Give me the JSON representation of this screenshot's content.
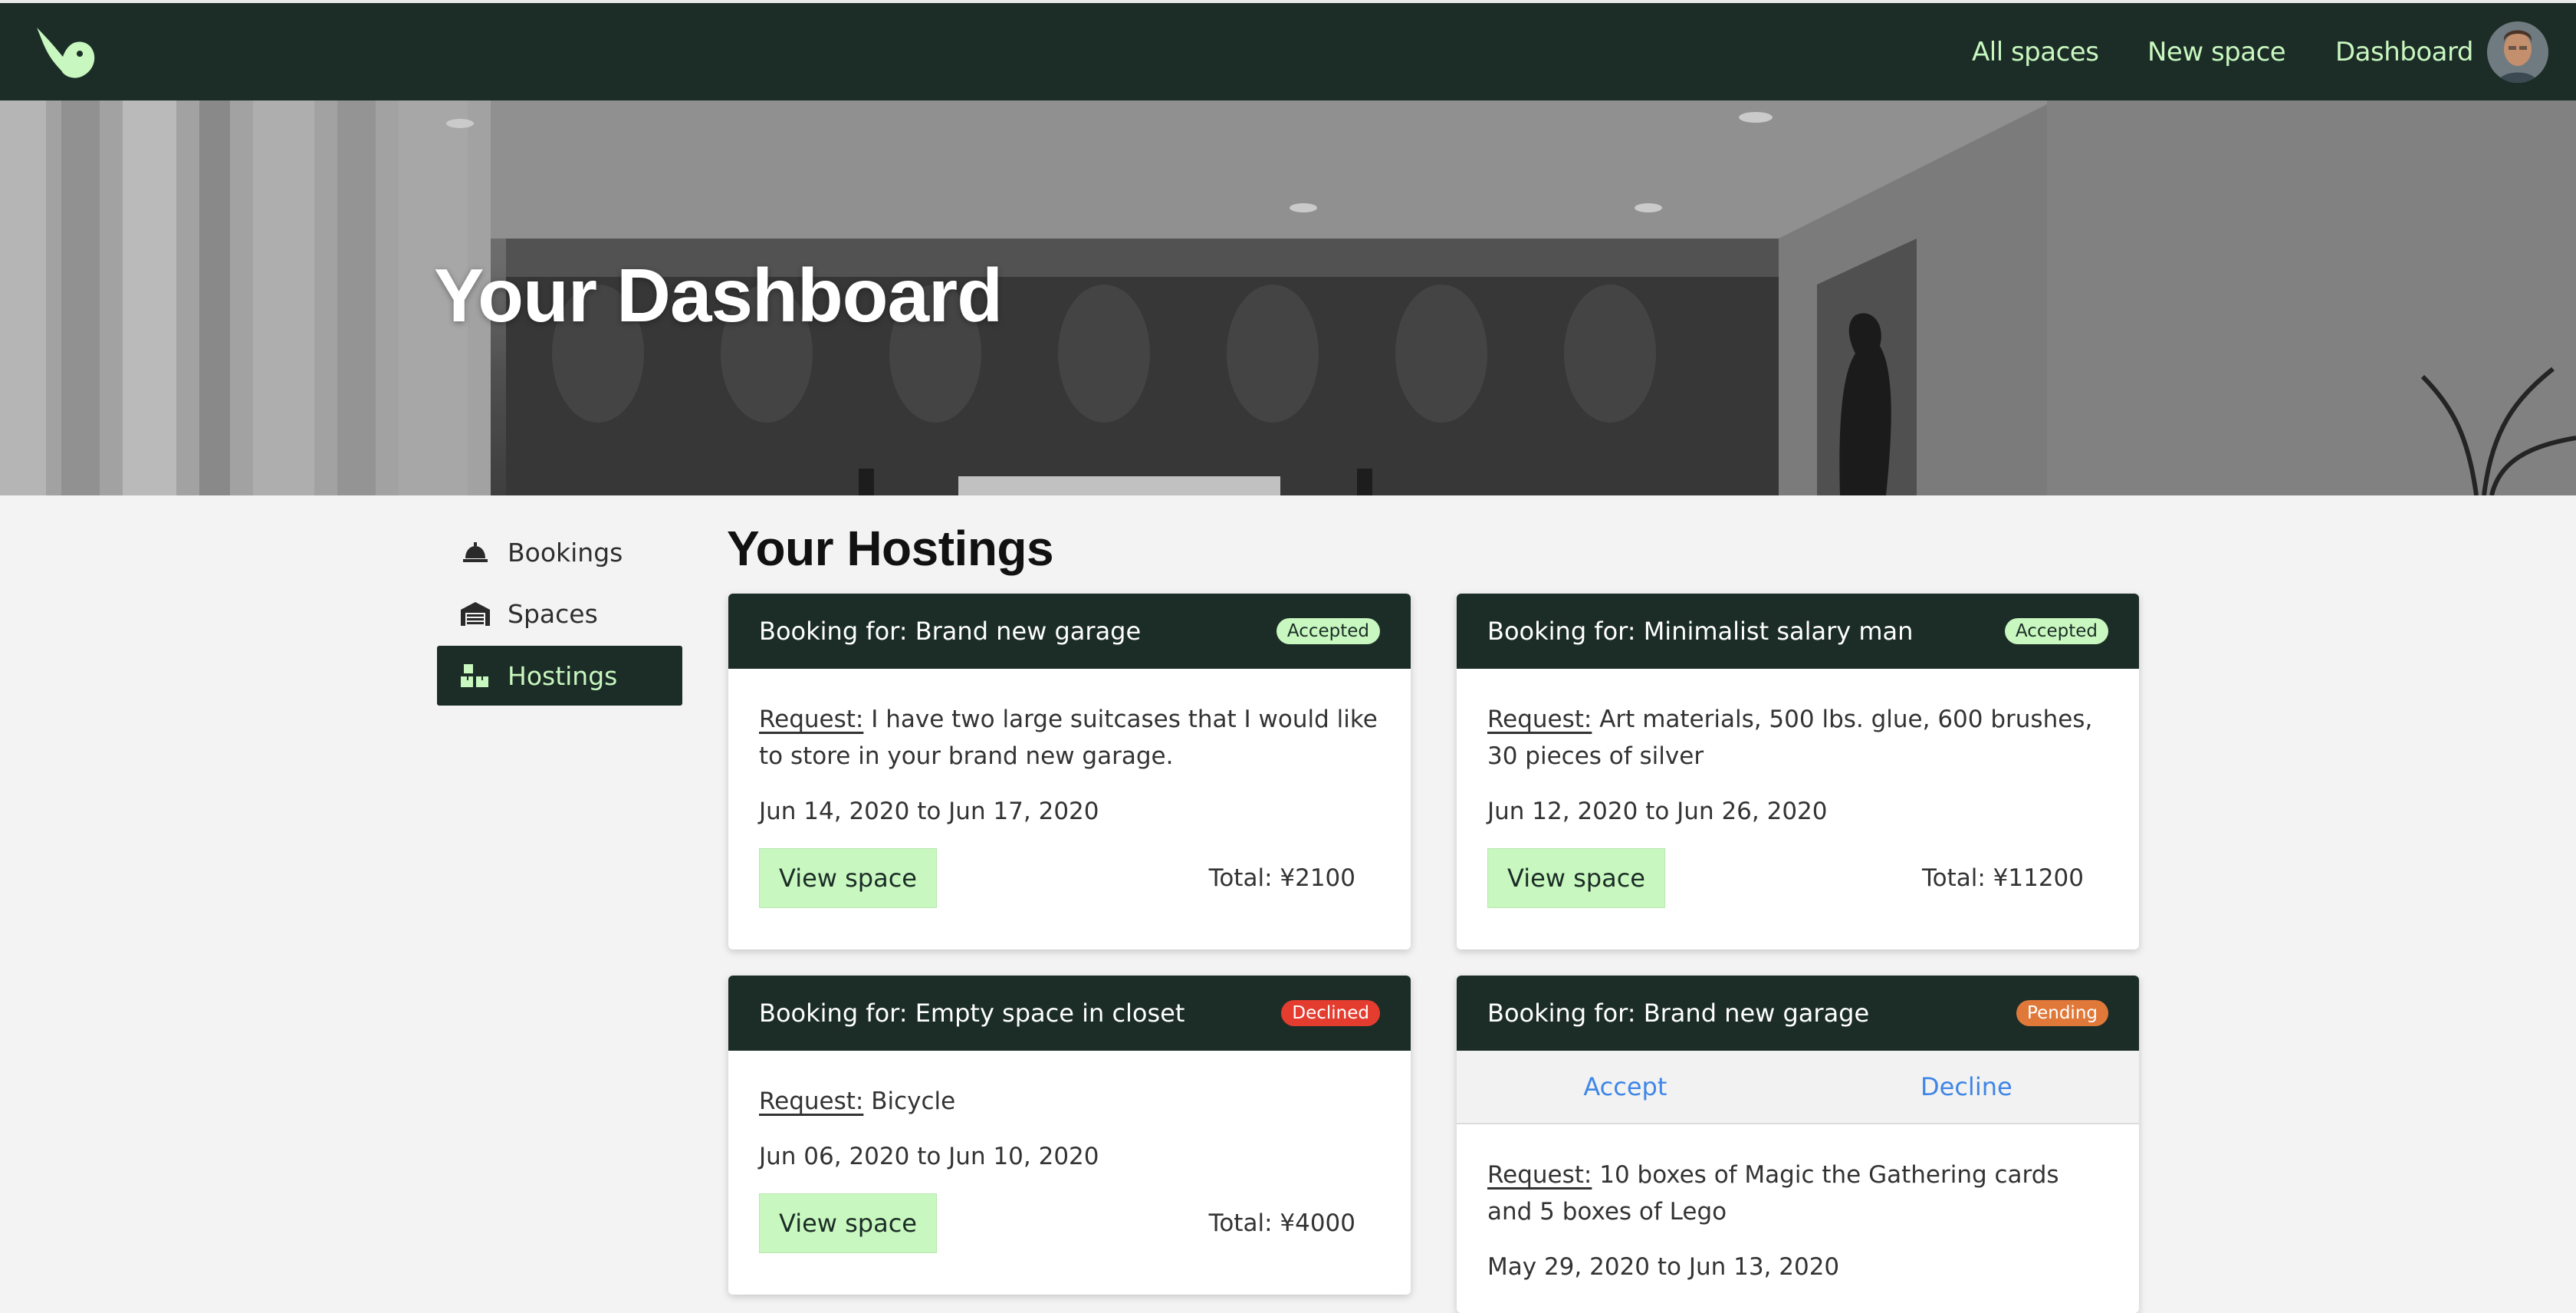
{
  "nav": {
    "links": [
      "All spaces",
      "New space",
      "Dashboard"
    ]
  },
  "hero": {
    "title": "Your Dashboard"
  },
  "sidebar": {
    "items": [
      {
        "label": "Bookings",
        "icon": "bell-icon",
        "active": false
      },
      {
        "label": "Spaces",
        "icon": "garage-icon",
        "active": false
      },
      {
        "label": "Hostings",
        "icon": "boxes-icon",
        "active": true
      }
    ]
  },
  "main": {
    "title": "Your Hostings",
    "cards": [
      {
        "header": "Booking for: Brand new garage",
        "status": "Accepted",
        "request_label": "Request:",
        "request": " I have two large suitcases that I would like to store in your brand new garage.",
        "dates": "Jun 14, 2020 to Jun 17, 2020",
        "button": "View space",
        "total": "Total: ¥2100"
      },
      {
        "header": "Booking for: Minimalist salary man",
        "status": "Accepted",
        "request_label": "Request:",
        "request": " Art materials, 500 lbs. glue, 600 brushes, 30 pieces of silver",
        "dates": "Jun 12, 2020 to Jun 26, 2020",
        "button": "View space",
        "total": "Total: ¥11200"
      },
      {
        "header": "Booking for: Empty space in closet",
        "status": "Declined",
        "request_label": "Request:",
        "request": " Bicycle",
        "dates": "Jun 06, 2020 to Jun 10, 2020",
        "button": "View space",
        "total": "Total: ¥4000"
      },
      {
        "header": "Booking for: Brand new garage",
        "status": "Pending",
        "accept": "Accept",
        "decline": "Decline",
        "request_label": "Request:",
        "request": " 10 boxes of Magic the Gathering cards and 5 boxes of Lego",
        "dates": "May 29, 2020 to Jun 13, 2020"
      }
    ]
  },
  "colors": {
    "nav_bg": "#1c2d27",
    "accent_green": "#c8f7bf",
    "accepted": "#c8f7bf",
    "declined": "#e43d30",
    "pending": "#e0783a",
    "link_blue": "#3f86e6"
  }
}
